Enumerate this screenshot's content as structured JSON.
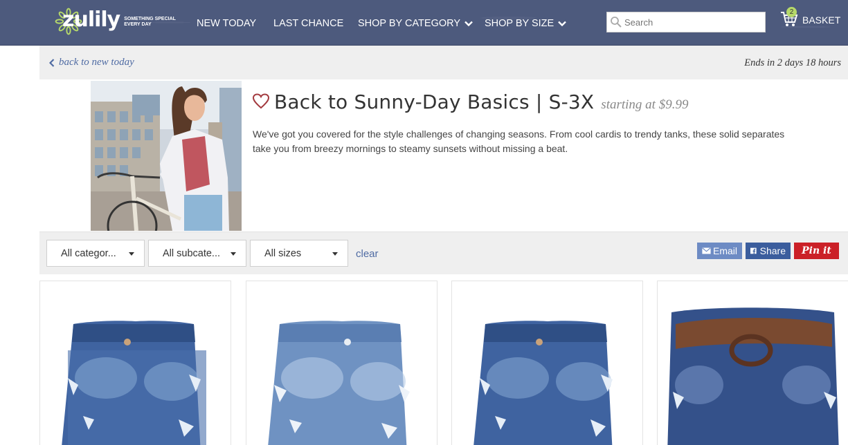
{
  "header": {
    "logo_text": "zulily",
    "logo_tagline": "SOMETHING SPECIAL EVERY DAY",
    "nav": [
      {
        "label": "NEW TODAY",
        "has_chevron": false
      },
      {
        "label": "LAST CHANCE",
        "has_chevron": false
      },
      {
        "label": "SHOP BY CATEGORY",
        "has_chevron": true
      },
      {
        "label": "SHOP BY SIZE",
        "has_chevron": true
      }
    ],
    "search_placeholder": "Search",
    "basket_label": "BASKET",
    "basket_count": "2"
  },
  "subbar": {
    "back_label": "back to new today",
    "ends_in": "Ends in 2 days 18 hours"
  },
  "event": {
    "title": "Back to Sunny-Day Basics | S-3X",
    "price_label": "starting at $9.99",
    "description": "We've got you covered for the style challenges of changing seasons. From cool cardis to trendy tanks, these solid separates take you from breezy mornings to steamy sunsets without missing a beat."
  },
  "filters": {
    "category": "All categor...",
    "subcategory": "All subcate...",
    "sizes": "All sizes",
    "clear_label": "clear"
  },
  "share": {
    "email_label": "Email",
    "facebook_label": "Share",
    "pinterest_label": "Pin it"
  },
  "products": [
    {
      "name": "distressed denim shorts",
      "wash": "dark"
    },
    {
      "name": "distressed denim shorts",
      "wash": "light"
    },
    {
      "name": "distressed denim shorts",
      "wash": "dark"
    },
    {
      "name": "belted denim shorts",
      "wash": "dark"
    }
  ],
  "colors": {
    "header_bg": "#4d5a7d",
    "link_blue": "#4f6ba3",
    "basket_badge": "#b6d96a",
    "email_btn": "#6d8bc4",
    "facebook_btn": "#3b5d9d",
    "pinterest_btn": "#cb2027"
  }
}
